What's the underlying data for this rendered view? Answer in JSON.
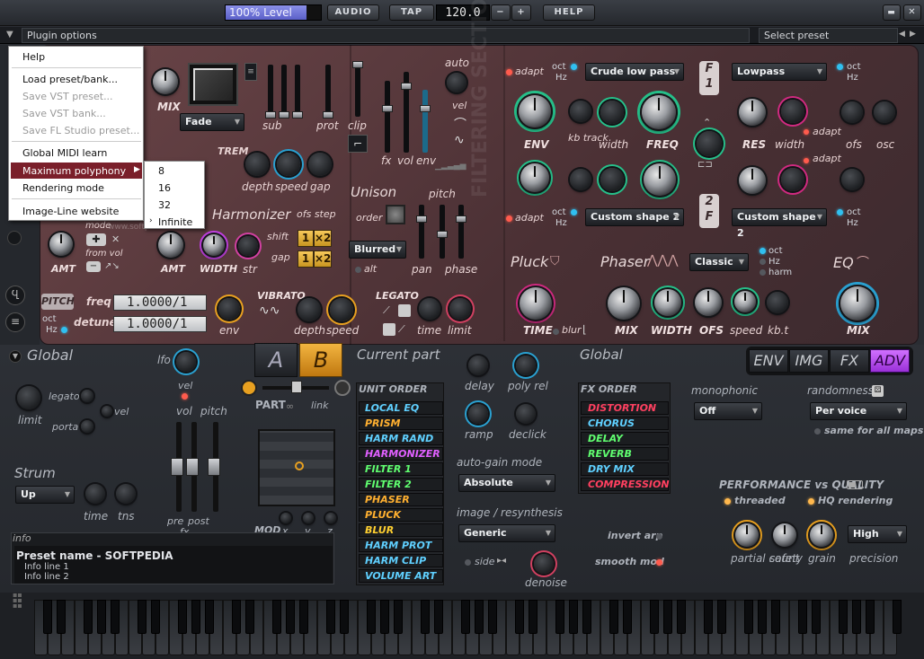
{
  "topbar": {
    "level_label": "100% Level",
    "audio_label": "AUDIO",
    "tap_label": "TAP",
    "tempo": "120.0",
    "tempo_minus": "−",
    "tempo_plus": "+",
    "help_label": "HELP",
    "minimize_label": "▬",
    "close_label": "✕"
  },
  "optionsbar": {
    "plugin_options": "Plugin options",
    "select_preset": "Select preset"
  },
  "menu": {
    "items": [
      "Help",
      "Load preset/bank...",
      "Save VST preset...",
      "Save VST bank...",
      "Save FL Studio preset...",
      "Global MIDI learn",
      "Maximum polyphony",
      "Rendering mode",
      "Image-Line website"
    ],
    "submenu": [
      "8",
      "16",
      "32",
      "Infinite"
    ]
  },
  "watermark": {
    "main": "SOFTPEDIA",
    "url": "www.softpedia.com"
  },
  "synth": {
    "mix_label": "MIX",
    "fade_value": "Fade",
    "sub_label": "sub",
    "prot_label": "prot",
    "clip_label": "clip",
    "fx_label": "fx",
    "vol_label": "vol",
    "env_label": "env",
    "auto_label": "auto",
    "vel_label": "vel",
    "trem_label": "TREM",
    "depth_label": "depth",
    "speed_label": "speed",
    "gap_label": "gap",
    "harmonizer_label": "Harmonizer",
    "ofs_step_label": "ofs step",
    "shift_label": "shift",
    "gap2_label": "gap",
    "x1": "1",
    "x2": "×2",
    "x1b": "1",
    "x2b": "×2",
    "amt_label": "AMT",
    "amt2_label": "AMT",
    "width_label": "WIDTH",
    "str_label": "str",
    "mode_label": "mode",
    "from_vol_label": "from vol",
    "unison_label": "Unison",
    "order_label": "order",
    "pitch_label": "pitch",
    "blurred_value": "Blurred",
    "alt_label": "alt",
    "pan_label": "pan",
    "phase_label": "phase",
    "pitch_section": "PITCH",
    "freq_label": "freq",
    "detune_label": "detune",
    "freq_value": "1.0000/1",
    "detune_value": "1.0000/1",
    "oct_label": "oct",
    "hz_label": "Hz",
    "env2_label": "env",
    "vibrato_label": "VIBRATO",
    "vdepth_label": "depth",
    "vspeed_label": "speed",
    "legato_label": "LEGATO",
    "time_label": "time",
    "limit_label": "limit",
    "filtering_section": "FILTERING SECTION",
    "adapt_label": "adapt",
    "oct1": "oct",
    "hz1": "Hz",
    "filter1_shape": "Crude low pass",
    "filter1_type": "Lowpass",
    "env_f_label": "ENV",
    "kb_track_label": "kb track",
    "fwidth_label": "width",
    "freq_f_label": "FREQ",
    "res_label": "RES",
    "width2_label": "width",
    "ofs_label": "ofs",
    "osc_label": "osc",
    "adapt2_label": "adapt",
    "adapt3_label": "adapt",
    "adapt4_label": "adapt",
    "filter2_shape": "Custom shape 2",
    "filter2_type": "Custom shape 2",
    "f1_badge": "F 1",
    "f2_badge": "2 F",
    "pluck_label": "Pluck",
    "phaser_label": "Phaser",
    "phaser_mode": "Classic",
    "harm_label": "harm",
    "eq_label": "EQ",
    "ptime_label": "TIME",
    "blur_label": "blur",
    "pmix_label": "MIX",
    "pwidth_label": "WIDTH",
    "pofs_label": "OFS",
    "pspeed_label": "speed",
    "kbt_label": "kb.t",
    "eqmix_label": "MIX"
  },
  "rack": {
    "global_label": "Global",
    "lfo_label": "lfo",
    "vel_label": "vel",
    "vol_label": "vol",
    "pitch_label": "pitch",
    "legato_label": "legato",
    "porta_label": "porta",
    "vel2_label": "vel",
    "limit_label": "limit",
    "strum_label": "Strum",
    "strum_value": "Up",
    "time_label": "time",
    "tns_label": "tns",
    "pre_label": "pre",
    "post_label": "post",
    "fx_label": "fx",
    "a_label": "A",
    "b_label": "B",
    "current_part": "Current part",
    "part_label": "PART",
    "link_label": "link",
    "mod_label": "MOD",
    "x_label": "x",
    "y_label": "y",
    "z_label": "z",
    "unit_order_label": "UNIT ORDER",
    "units": [
      {
        "name": "LOCAL EQ",
        "color": "#5fd0ff"
      },
      {
        "name": "PRISM",
        "color": "#ffb030"
      },
      {
        "name": "HARM RAND",
        "color": "#5fd0ff"
      },
      {
        "name": "HARMONIZER",
        "color": "#e060ff"
      },
      {
        "name": "FILTER 1",
        "color": "#60ff70"
      },
      {
        "name": "FILTER 2",
        "color": "#60ff70"
      },
      {
        "name": "PHASER",
        "color": "#ffb030"
      },
      {
        "name": "PLUCK",
        "color": "#ffb030"
      },
      {
        "name": "BLUR",
        "color": "#ffd030"
      },
      {
        "name": "HARM PROT",
        "color": "#5fd0ff"
      },
      {
        "name": "HARM CLIP",
        "color": "#5fd0ff"
      },
      {
        "name": "VOLUME ART",
        "color": "#5fd0ff"
      }
    ],
    "delay_label": "delay",
    "poly_rel_label": "poly rel",
    "ramp_label": "ramp",
    "declick_label": "declick",
    "autogain_label": "auto-gain mode",
    "autogain_value": "Absolute",
    "image_label": "image / resynthesis",
    "image_value": "Generic",
    "side_label": "side",
    "denoise_label": "denoise",
    "global2_label": "Global",
    "fx_order_label": "FX ORDER",
    "fx_units": [
      {
        "name": "DISTORTION",
        "color": "#ff4060"
      },
      {
        "name": "CHORUS",
        "color": "#5fd0ff"
      },
      {
        "name": "DELAY",
        "color": "#60ff70"
      },
      {
        "name": "REVERB",
        "color": "#60ff70"
      },
      {
        "name": "DRY MIX",
        "color": "#5fd0ff"
      },
      {
        "name": "COMPRESSION",
        "color": "#ff4060"
      }
    ],
    "invert_arp_label": "invert arp",
    "smooth_mod_label": "smooth mod",
    "monophonic_label": "monophonic",
    "monophonic_value": "Off",
    "randomness_label": "randomness",
    "randomness_value": "Per voice",
    "same_for_all_maps": "same for all maps",
    "perf_label": "PERFORMANCE vs QUALITY",
    "threaded_label": "threaded",
    "hq_label": "HQ rendering",
    "partial_count_label": "partial count",
    "safety_label": "safety",
    "grain_label": "grain",
    "precision_label": "precision",
    "precision_value": "High",
    "tabs": [
      "ENV",
      "IMG",
      "FX",
      "ADV"
    ]
  },
  "info": {
    "header": "info",
    "preset_name": "Preset name - SOFTPEDIA",
    "line1": "Info line 1",
    "line2": "Info line 2"
  },
  "colors": {
    "accent": "#c060ff",
    "orange": "#f0a030",
    "teal": "#30d0b0",
    "red_led": "#ff5b4d"
  }
}
